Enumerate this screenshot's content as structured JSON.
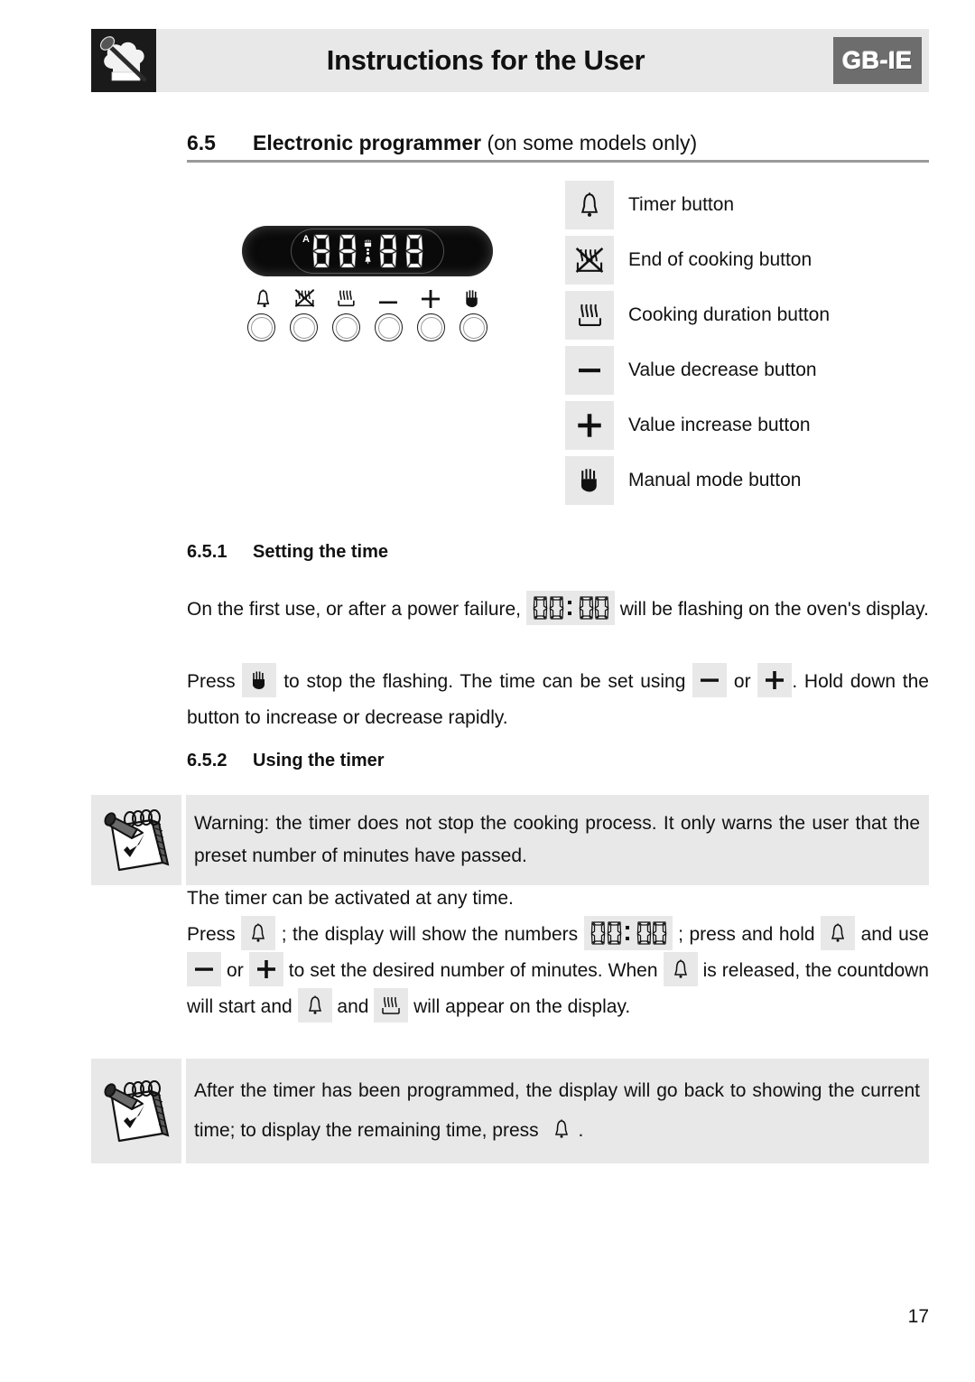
{
  "header": {
    "title": "Instructions for the User",
    "badge": "GB-IE",
    "logo_icon": "chef-hat-spoon-logo"
  },
  "section": {
    "number": "6.5",
    "title_bold": "Electronic programmer",
    "title_regular": " (on some models only)"
  },
  "programmer": {
    "display_value": "88:88",
    "auto_indicator": "A",
    "indicator_icons": [
      "pot-icon",
      "bell-icon"
    ],
    "buttons": [
      {
        "icon": "bell-icon",
        "name": "timer-button"
      },
      {
        "icon": "end-of-cooking-icon",
        "name": "end-of-cooking-button"
      },
      {
        "icon": "cooking-duration-icon",
        "name": "cooking-duration-button"
      },
      {
        "icon": "minus-icon",
        "name": "value-decrease-button"
      },
      {
        "icon": "plus-icon",
        "name": "value-increase-button"
      },
      {
        "icon": "hand-icon",
        "name": "manual-mode-button"
      }
    ]
  },
  "legend": [
    {
      "icon": "bell-icon",
      "label": "Timer button"
    },
    {
      "icon": "end-of-cooking-icon",
      "label": "End of cooking button"
    },
    {
      "icon": "cooking-duration-icon",
      "label": "Cooking duration button"
    },
    {
      "icon": "minus-icon",
      "label": "Value decrease button"
    },
    {
      "icon": "plus-icon",
      "label": "Value increase button"
    },
    {
      "icon": "hand-icon",
      "label": "Manual mode button"
    }
  ],
  "subsection_1": {
    "number": "6.5.1",
    "title": "Setting the time",
    "para_1_a": "On the first use, or after a power failure,",
    "para_1_lcd": "00:00",
    "para_1_b": "will be flashing on the oven's display.",
    "para_2_a": "Press",
    "para_2_b": "to stop the flashing. The time can be set using",
    "para_2_c": "or",
    "para_2_d": ". Hold down the button to increase or decrease rapidly."
  },
  "subsection_2": {
    "number": "6.5.2",
    "title": "Using the timer",
    "note_1": "Warning: the timer does not stop the cooking process. It only warns the user that the preset number of minutes have passed.",
    "para_1": "The timer can be activated at any time.",
    "para_2_a": "Press",
    "para_2_b": "; the display will show the numbers",
    "para_2_lcd": "00:00",
    "para_2_c": "; press and hold",
    "para_2_d": "and use",
    "para_2_e": "or",
    "para_2_f": "to set the desired number of minutes. When",
    "para_2_g": "is released, the countdown will start and",
    "para_2_h": "and",
    "para_2_i": "will appear on the display.",
    "note_2_a": "After the timer has been programmed, the display will go back to showing the current time; to display the remaining time, press",
    "note_2_b": "."
  },
  "footer": {
    "page_number": "17"
  },
  "colors": {
    "chip_bg": "#e8e8e8",
    "badge_bg": "#6d6d6d",
    "rule": "#9a9a9a",
    "text": "#111111"
  }
}
